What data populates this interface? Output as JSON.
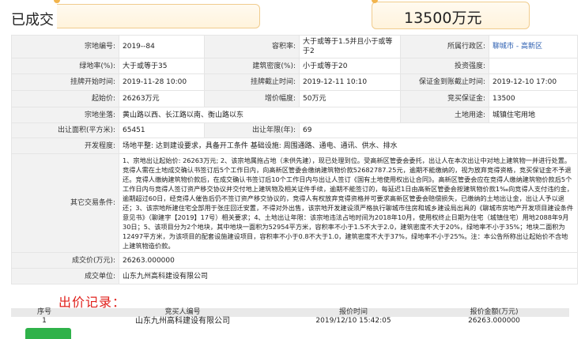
{
  "header": {
    "status": "已成交",
    "final_price": "13500万元"
  },
  "rows": [
    [
      {
        "label": "宗地编号:",
        "value": "2019--84"
      },
      {
        "label": "容积率:",
        "value": "大于或等于1.5并且小于或等于2"
      },
      {
        "label": "所属行政区:",
        "value": "聊城市 - 高新区"
      }
    ],
    [
      {
        "label": "绿地率(%):",
        "value": "大于或等于35"
      },
      {
        "label": "建筑密度(%):",
        "value": "小于或等于20"
      },
      {
        "label": "投资强度:",
        "value": ""
      }
    ],
    [
      {
        "label": "挂牌开始时间:",
        "value": "2019-11-28 10:00"
      },
      {
        "label": "挂牌截止时间:",
        "value": "2019-12-11 10:10"
      },
      {
        "label": "保证金到账截止时间:",
        "value": "2019-12-10 17:00"
      }
    ],
    [
      {
        "label": "起始价:",
        "value": "26263万元"
      },
      {
        "label": "增价幅度:",
        "value": "50万元"
      },
      {
        "label": "竞买保证金:",
        "value": "13500"
      }
    ]
  ],
  "location": {
    "label": "宗地坐落:",
    "value": "黄山路以西、长江路以南、衡山路以东"
  },
  "land_use": {
    "label": "土地用途:",
    "value": "城镇住宅用地"
  },
  "area": {
    "label": "出让面积(平方米):",
    "value": "65451"
  },
  "term": {
    "label": "出让年限(年):",
    "value": "69"
  },
  "development": {
    "label": "开发程度:",
    "value": "场地平整: 达到建设要求，具备开工条件 基础设施: 周围通路、通电、通讯、供水、排水"
  },
  "other_conditions": {
    "label": "其它交易条件:",
    "value": "1、宗地出让起始价: 26263万元; 2、该宗地属拖占地（未供先建），现已处理到位。受高新区管委会委托，出让人在本次出让中对地上建筑物一并进行处置。竞得人需在土地成交确认书签订后5个工作日内，向高新区管委会缴纳建筑物价款52682787.25元，逾期不能缴纳的，视为放弃竞得资格，竞买保证金不予退还。竞得人缴纳建筑物价款后，在成交确认书签订后10个工作日内与出让人签订《国有土地使用权出让合同》。高新区管委会应在竞得人缴纳建筑物价款后5个工作日内与竞得人签订资产移交协议并交付地上建筑物及相关证件手续，逾期不能签订的，每延迟1日由高新区管委会按建筑物价款1‰向竞得人支付违约金，逾期超过60日，经竞得人催告后仍不签订资产移交协议的，竞得人有权放弃竞得资格并可要求高新区管委会赔偿损失，已缴纳的土地出让金，出让人予以退还；3、该宗地所建住宅全部用于张庄回迁安置，不得对外出售，该宗地开发建设须严格执行聊城市住房和城乡建设局出具的《聊城市房地产开发项目建设条件意见书》（聊建字【2019】17号）相关要求；4、土地出让年限：该宗地违法占地时间为2018年10月，使用权终止日期为住宅（城镇住宅）用地2088年9月30日；5、该项目分为2个地块，其中地块一面积为52954平方米，容积率不小于1.5不大于2.0，建筑密度不大于20%，绿地率不小于35%；地块二面积为12497平方米，为该项目的配套设施建设项目，容积率不小于0.8不大于1.0，建筑密度不大于37%，绿地率不小于25%。注：本公告所称出让起始价不含地上建筑物造价款。"
  },
  "deal_price": {
    "label": "成交价(万元):",
    "value": "26263.000000"
  },
  "deal_unit": {
    "label": "成交单位:",
    "value": "山东九州高科建设有限公司"
  },
  "bid_record": {
    "title": "出价记录：",
    "columns": [
      "序号",
      "竞买人编号",
      "报价时间",
      "报价金额(万元)"
    ],
    "rows": [
      {
        "no": "1",
        "bidder": "山东九州高科建设有限公司",
        "time": "2019/12/10 15:42:05",
        "amount": "26263.000000"
      }
    ]
  },
  "colors": {
    "accent_red": "#e0201b",
    "label_bg": "#f2f2f2",
    "bubble_border": "#f0cc8e",
    "action_green": "#2fb24a"
  }
}
